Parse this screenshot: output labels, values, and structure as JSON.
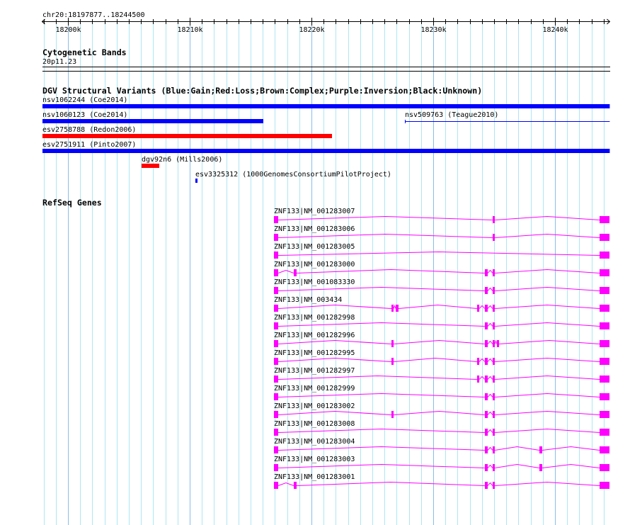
{
  "ruler": {
    "label": "chr20:18197877..18244500",
    "start": 18197877,
    "end": 18244500,
    "major_ticks": [
      {
        "pos": 18200000,
        "label": "18200k"
      },
      {
        "pos": 18210000,
        "label": "18210k"
      },
      {
        "pos": 18220000,
        "label": "18220k"
      },
      {
        "pos": 18230000,
        "label": "18230k"
      },
      {
        "pos": 18240000,
        "label": "18240k"
      }
    ]
  },
  "cyto": {
    "title": "Cytogenetic Bands",
    "band": "20p11.23"
  },
  "dgv": {
    "title": "DGV Structural Variants (Blue:Gain;Red:Loss;Brown:Complex;Purple:Inversion;Black:Unknown)",
    "variants": [
      {
        "label": "nsv1062244 (Coe2014)",
        "start": 18197877,
        "end": 18244500,
        "color": "#0000ff",
        "style": "bar",
        "row": 0
      },
      {
        "label": "nsv1060123 (Coe2014)",
        "start": 18197877,
        "end": 18216047,
        "color": "#0000ff",
        "style": "bar",
        "row": 1
      },
      {
        "label": "nsv509763 (Teague2010)",
        "start": 18227674,
        "end": 18244500,
        "color": "#0000ff",
        "style": "line",
        "row": 1
      },
      {
        "label": "esv2758788 (Redon2006)",
        "start": 18197877,
        "end": 18221686,
        "color": "#ff0000",
        "style": "bar",
        "row": 2
      },
      {
        "label": "esv2751911 (Pinto2007)",
        "start": 18197877,
        "end": 18244500,
        "color": "#0000ff",
        "style": "bar",
        "row": 3
      },
      {
        "label": "dgv92n6 (Mills2006)",
        "start": 18206047,
        "end": 18207500,
        "color": "#ff0000",
        "style": "bar",
        "row": 4
      },
      {
        "label": "esv3325312 (1000GenomesConsortiumPilotProject)",
        "start": 18210465,
        "end": 18210640,
        "color": "#0000ff",
        "style": "bar",
        "row": 5
      }
    ]
  },
  "refseq": {
    "title": "RefSeq Genes",
    "color": "#ff00ff",
    "transcripts": [
      {
        "label": "ZNF133|NM_001283007",
        "exons": [
          [
            18216919,
            18217267
          ],
          [
            18234884,
            18235058
          ],
          [
            18243663,
            18244500
          ]
        ]
      },
      {
        "label": "ZNF133|NM_001283006",
        "exons": [
          [
            18216919,
            18217267
          ],
          [
            18234884,
            18235058
          ],
          [
            18243663,
            18244500
          ]
        ]
      },
      {
        "label": "ZNF133|NM_001283005",
        "exons": [
          [
            18216919,
            18217267
          ],
          [
            18243663,
            18244500
          ]
        ]
      },
      {
        "label": "ZNF133|NM_001283000",
        "exons": [
          [
            18216919,
            18217267
          ],
          [
            18218547,
            18218779
          ],
          [
            18234244,
            18234477
          ],
          [
            18234884,
            18235058
          ],
          [
            18243663,
            18244500
          ]
        ]
      },
      {
        "label": "ZNF133|NM_001083330",
        "exons": [
          [
            18216919,
            18217267
          ],
          [
            18234244,
            18234477
          ],
          [
            18234884,
            18235058
          ],
          [
            18243663,
            18244500
          ]
        ]
      },
      {
        "label": "ZNF133|NM_003434",
        "exons": [
          [
            18216919,
            18217267
          ],
          [
            18226570,
            18226744
          ],
          [
            18226919,
            18227151
          ],
          [
            18233605,
            18233779
          ],
          [
            18234244,
            18234477
          ],
          [
            18234884,
            18235058
          ],
          [
            18243663,
            18244500
          ]
        ]
      },
      {
        "label": "ZNF133|NM_001282998",
        "exons": [
          [
            18216919,
            18217267
          ],
          [
            18234244,
            18234477
          ],
          [
            18234884,
            18235058
          ],
          [
            18243663,
            18244500
          ]
        ]
      },
      {
        "label": "ZNF133|NM_001282996",
        "exons": [
          [
            18216919,
            18217267
          ],
          [
            18226570,
            18226744
          ],
          [
            18234244,
            18234477
          ],
          [
            18234884,
            18235000
          ],
          [
            18235233,
            18235349
          ],
          [
            18243663,
            18244500
          ]
        ]
      },
      {
        "label": "ZNF133|NM_001282995",
        "exons": [
          [
            18216919,
            18217267
          ],
          [
            18226570,
            18226744
          ],
          [
            18233605,
            18233779
          ],
          [
            18234244,
            18234477
          ],
          [
            18234884,
            18235058
          ],
          [
            18243663,
            18244500
          ]
        ]
      },
      {
        "label": "ZNF133|NM_001282997",
        "exons": [
          [
            18216919,
            18217267
          ],
          [
            18233605,
            18233779
          ],
          [
            18234244,
            18234477
          ],
          [
            18234884,
            18235058
          ],
          [
            18243663,
            18244500
          ]
        ]
      },
      {
        "label": "ZNF133|NM_001282999",
        "exons": [
          [
            18216919,
            18217267
          ],
          [
            18234244,
            18234477
          ],
          [
            18234884,
            18235058
          ],
          [
            18243663,
            18244500
          ]
        ]
      },
      {
        "label": "ZNF133|NM_001283002",
        "exons": [
          [
            18216919,
            18217267
          ],
          [
            18226570,
            18226744
          ],
          [
            18234244,
            18234477
          ],
          [
            18234884,
            18235058
          ],
          [
            18243663,
            18244500
          ]
        ]
      },
      {
        "label": "ZNF133|NM_001283008",
        "exons": [
          [
            18216919,
            18217267
          ],
          [
            18234244,
            18234477
          ],
          [
            18234884,
            18235058
          ],
          [
            18243663,
            18244500
          ]
        ]
      },
      {
        "label": "ZNF133|NM_001283004",
        "exons": [
          [
            18216919,
            18217267
          ],
          [
            18234244,
            18234477
          ],
          [
            18234884,
            18235058
          ],
          [
            18238721,
            18238953
          ],
          [
            18243663,
            18244500
          ]
        ]
      },
      {
        "label": "ZNF133|NM_001283003",
        "exons": [
          [
            18216919,
            18217267
          ],
          [
            18234244,
            18234477
          ],
          [
            18234884,
            18235058
          ],
          [
            18238721,
            18238953
          ],
          [
            18243663,
            18244500
          ]
        ]
      },
      {
        "label": "ZNF133|NM_001283001",
        "exons": [
          [
            18216919,
            18217267
          ],
          [
            18218547,
            18218779
          ],
          [
            18234244,
            18234477
          ],
          [
            18234884,
            18235058
          ],
          [
            18243663,
            18244500
          ]
        ]
      }
    ]
  }
}
